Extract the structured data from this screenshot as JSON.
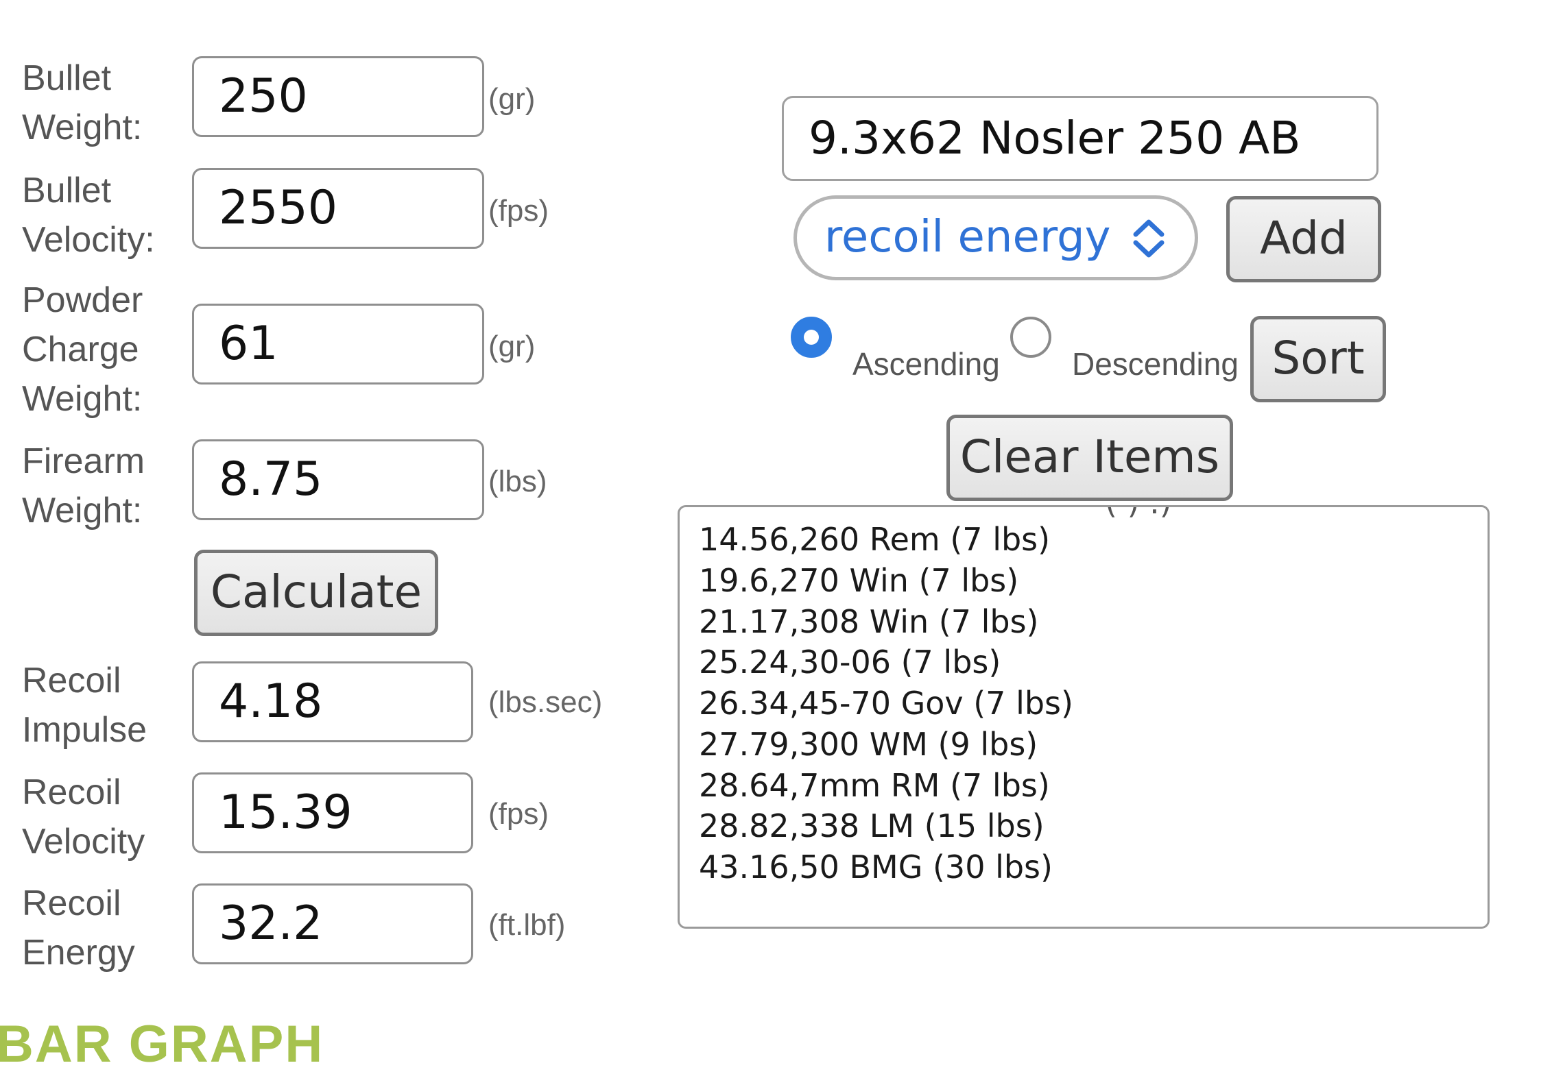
{
  "inputs": {
    "bullet_weight": {
      "label": "Bullet\nWeight:",
      "value": "250",
      "unit": "(gr)"
    },
    "bullet_velocity": {
      "label": "Bullet\nVelocity:",
      "value": "2550",
      "unit": "(fps)"
    },
    "powder_charge_weight": {
      "label": "Powder\nCharge\nWeight:",
      "value": "61",
      "unit": "(gr)"
    },
    "firearm_weight": {
      "label": "Firearm\nWeight:",
      "value": "8.75",
      "unit": "(lbs)"
    }
  },
  "calculate_label": "Calculate",
  "results": {
    "recoil_impulse": {
      "label": "Recoil\nImpulse",
      "value": "4.18",
      "unit": "(lbs.sec)"
    },
    "recoil_velocity": {
      "label": "Recoil\nVelocity",
      "value": "15.39",
      "unit": "(fps)"
    },
    "recoil_energy": {
      "label": "Recoil\nEnergy",
      "value": "32.2",
      "unit": "(ft.lbf)"
    }
  },
  "compare": {
    "name_value": "9.3x62 Nosler 250 AB",
    "sort_field": "recoil energy",
    "add_label": "Add",
    "ascending_label": "Ascending",
    "descending_label": "Descending",
    "ascending_selected": true,
    "sort_label": "Sort",
    "clear_label": "Clear Items",
    "items": [
      "14.56,260 Rem (7 lbs)",
      "19.6,270 Win (7 lbs)",
      "21.17,308 Win (7 lbs)",
      "25.24,30-06 (7 lbs)",
      "26.34,45-70 Gov (7 lbs)",
      "27.79,300 WM (9 lbs)",
      "28.64,7mm RM (7 lbs)",
      "28.82,338 LM (15 lbs)",
      "43.16,50 BMG (30 lbs)"
    ]
  },
  "brand_text": "BAR GRAPH",
  "colors": {
    "accent_blue": "#2f7de1",
    "select_text": "#2f72d6",
    "brand_green": "#a6c24e"
  }
}
